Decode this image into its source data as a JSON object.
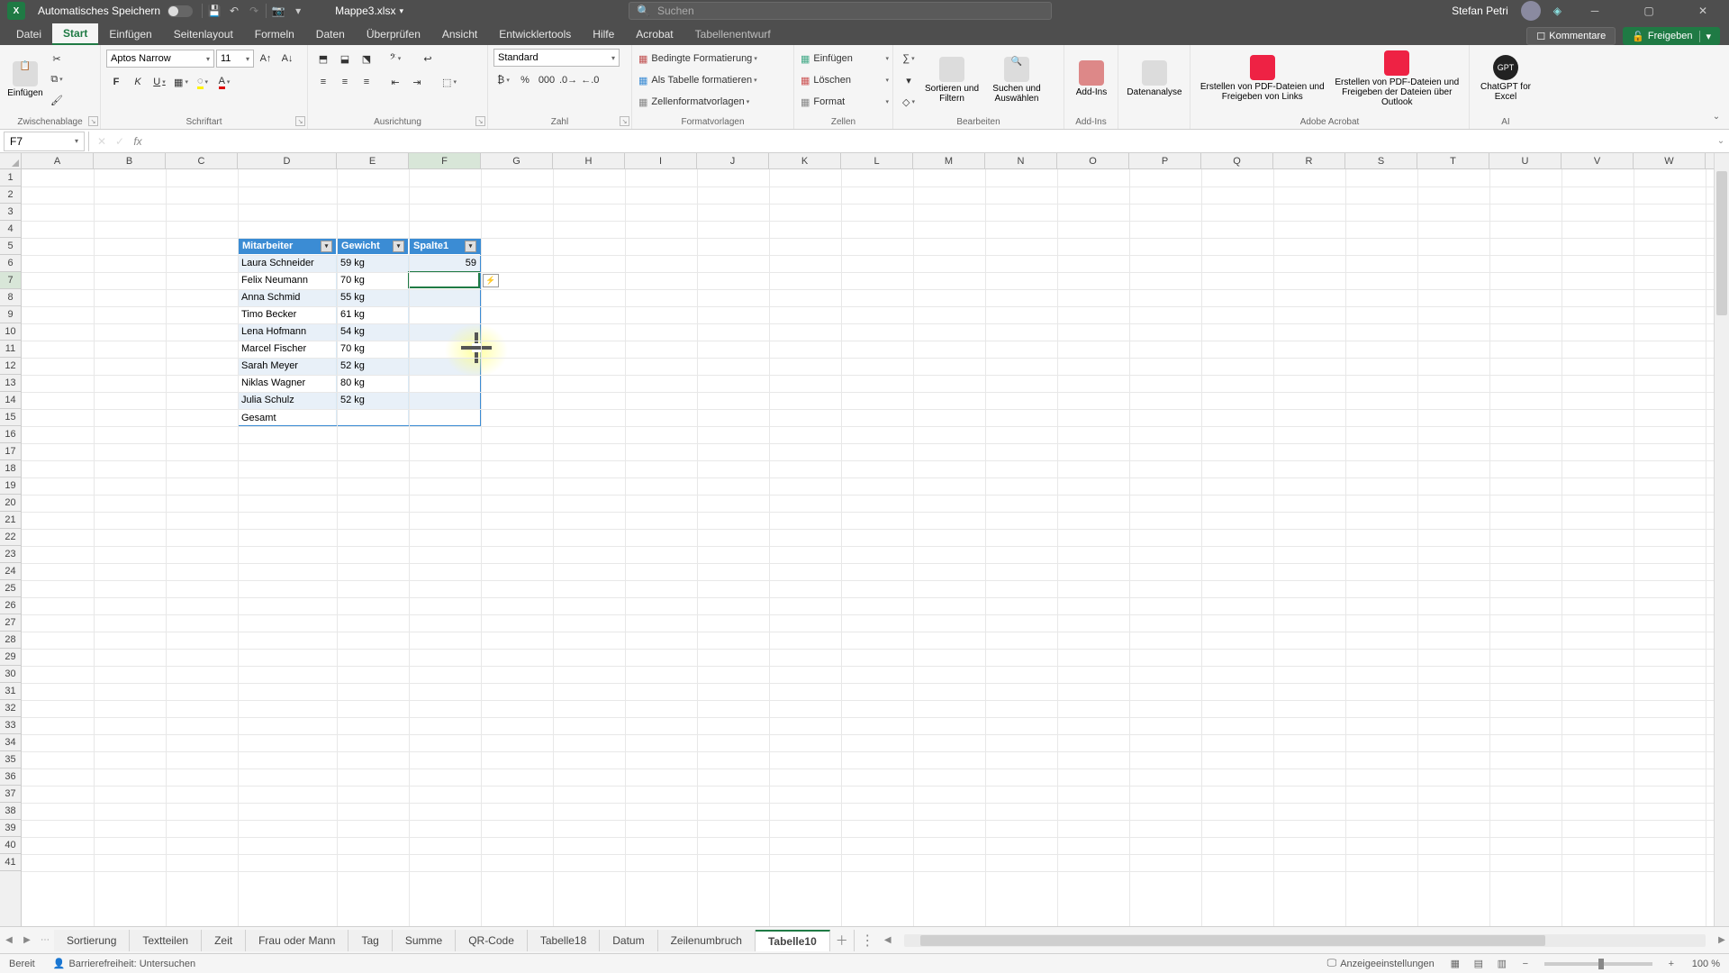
{
  "titlebar": {
    "app_icon": "X",
    "autosave_label": "Automatisches Speichern",
    "filename": "Mappe3.xlsx",
    "search_placeholder": "Suchen",
    "user_name": "Stefan Petri"
  },
  "ribbon_tabs": {
    "datei": "Datei",
    "start": "Start",
    "einfuegen": "Einfügen",
    "seitenlayout": "Seitenlayout",
    "formeln": "Formeln",
    "daten": "Daten",
    "ueberpruefen": "Überprüfen",
    "ansicht": "Ansicht",
    "entwicklertools": "Entwicklertools",
    "hilfe": "Hilfe",
    "acrobat": "Acrobat",
    "tabellenentwurf": "Tabellenentwurf",
    "kommentare": "Kommentare",
    "freigeben": "Freigeben"
  },
  "ribbon": {
    "clipboard": {
      "paste": "Einfügen",
      "label": "Zwischenablage"
    },
    "font": {
      "name": "Aptos Narrow",
      "size": "11",
      "bold": "F",
      "italic": "K",
      "underline": "U",
      "label": "Schriftart"
    },
    "align": {
      "label": "Ausrichtung"
    },
    "number": {
      "format": "Standard",
      "label": "Zahl"
    },
    "styles": {
      "cond": "Bedingte Formatierung",
      "astable": "Als Tabelle formatieren",
      "cellstyles": "Zellenformatvorlagen",
      "label": "Formatvorlagen"
    },
    "cells": {
      "insert": "Einfügen",
      "delete": "Löschen",
      "format": "Format",
      "label": "Zellen"
    },
    "editing": {
      "sort": "Sortieren und Filtern",
      "find": "Suchen und Auswählen",
      "label": "Bearbeiten"
    },
    "addins": {
      "addins": "Add-Ins",
      "label": "Add-Ins"
    },
    "analysis": {
      "label": "Datenanalyse"
    },
    "adobe": {
      "create": "Erstellen von PDF-Dateien und Freigeben von Links",
      "share": "Erstellen von PDF-Dateien und Freigeben der Dateien über Outlook",
      "label": "Adobe Acrobat"
    },
    "ai": {
      "gpt": "ChatGPT for Excel",
      "label": "AI"
    }
  },
  "fbar": {
    "namebox": "F7",
    "formula": ""
  },
  "columns": [
    "A",
    "B",
    "C",
    "D",
    "E",
    "F",
    "G",
    "H",
    "I",
    "J",
    "K",
    "L",
    "M",
    "N",
    "O",
    "P",
    "Q",
    "R",
    "S",
    "T",
    "U",
    "V",
    "W"
  ],
  "table": {
    "headers": {
      "c0": "Mitarbeiter",
      "c1": "Gewicht",
      "c2": "Spalte1"
    },
    "rows": [
      {
        "name": "Laura Schneider",
        "weight": "59 kg",
        "s1": "59"
      },
      {
        "name": "Felix Neumann",
        "weight": "70 kg",
        "s1": ""
      },
      {
        "name": "Anna Schmid",
        "weight": "55 kg",
        "s1": ""
      },
      {
        "name": "Timo Becker",
        "weight": "61 kg",
        "s1": ""
      },
      {
        "name": "Lena Hofmann",
        "weight": "54 kg",
        "s1": ""
      },
      {
        "name": "Marcel Fischer",
        "weight": "70 kg",
        "s1": ""
      },
      {
        "name": "Sarah Meyer",
        "weight": "52 kg",
        "s1": ""
      },
      {
        "name": "Niklas Wagner",
        "weight": "80 kg",
        "s1": ""
      },
      {
        "name": "Julia Schulz",
        "weight": "52 kg",
        "s1": ""
      }
    ],
    "total_label": "Gesamt"
  },
  "sheet_tabs": [
    "Sortierung",
    "Textteilen",
    "Zeit",
    "Frau oder Mann",
    "Tag",
    "Summe",
    "QR-Code",
    "Tabelle18",
    "Datum",
    "Zeilenumbruch",
    "Tabelle10"
  ],
  "statusbar": {
    "ready": "Bereit",
    "accessibility": "Barrierefreiheit: Untersuchen",
    "display_settings": "Anzeigeeinstellungen",
    "zoom": "100 %"
  }
}
